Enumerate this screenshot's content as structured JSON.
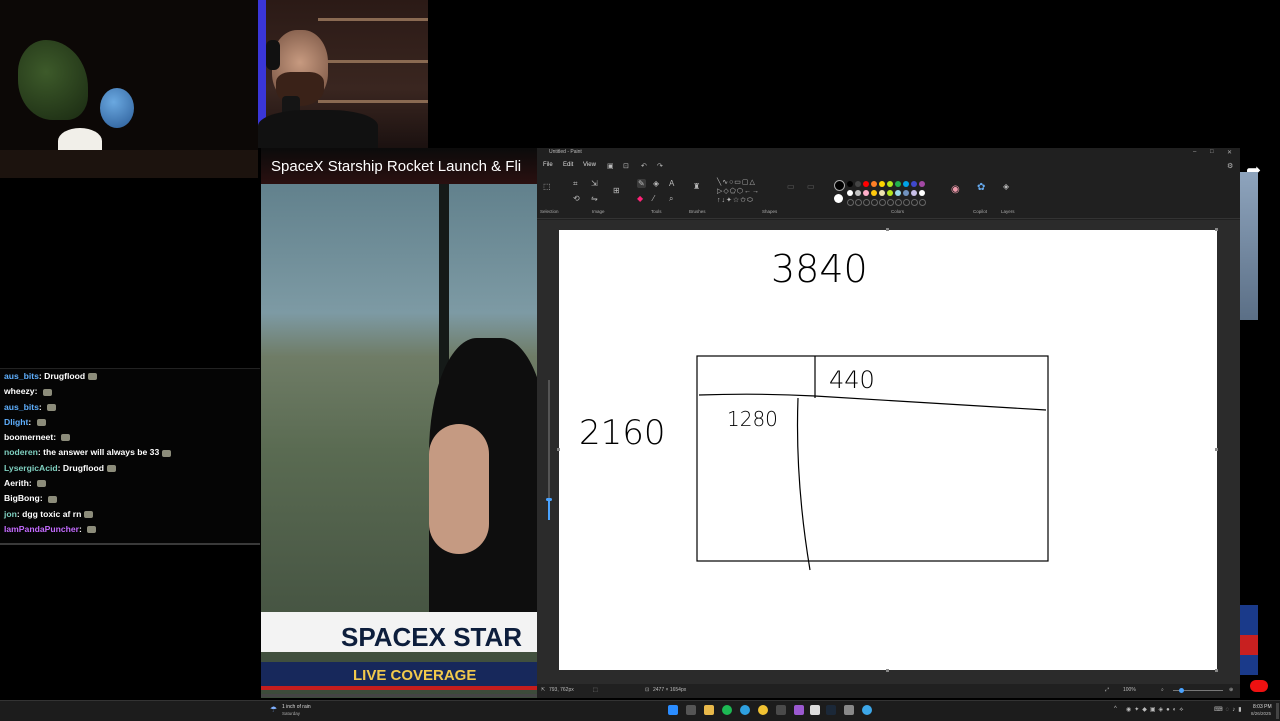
{
  "video": {
    "title": "SpaceX Starship Rocket Launch & Fli",
    "banner_main": "SPACEX STAR",
    "banner_sub": "LIVE COVERAGE"
  },
  "chat": {
    "messages": [
      {
        "user": "aus_bits",
        "text": "Drugflood",
        "color": "#5fb0ff"
      },
      {
        "user": "wheezy",
        "text": "",
        "color": "#ffffff"
      },
      {
        "user": "aus_bits",
        "text": "",
        "color": "#5fb0ff"
      },
      {
        "user": "Dlight",
        "text": "",
        "color": "#5fb0ff"
      },
      {
        "user": "boomerneet",
        "text": "",
        "color": "#ffffff"
      },
      {
        "user": "noderen",
        "text": "the answer will always be 33",
        "color": "#7fd0c0"
      },
      {
        "user": "LysergicAcid",
        "text": "Drugflood",
        "color": "#7fd0c0"
      },
      {
        "user": "Aerith",
        "text": "",
        "color": "#ffffff"
      },
      {
        "user": "BigBong",
        "text": "",
        "color": "#ffffff"
      },
      {
        "user": "jon",
        "text": "dgg toxic af rn",
        "color": "#7fd0c0"
      },
      {
        "user": "IamPandaPuncher",
        "text": "",
        "color": "#c46bff"
      }
    ]
  },
  "paint": {
    "title": "Untitled - Paint",
    "menu": [
      "File",
      "Edit",
      "View"
    ],
    "ribbon_groups": [
      "Selection",
      "Image",
      "Tools",
      "Brushes",
      "Shapes",
      "Colors",
      "Copilot",
      "Layers"
    ],
    "status_position": "793, 762px",
    "status_size": "2477 × 1654px",
    "zoom": "100%",
    "drawing": {
      "width_label": "3840",
      "height_label": "2160",
      "box_top_label": "440",
      "box_left_label": "1280"
    },
    "palette": [
      "#000000",
      "#444444",
      "#ff0000",
      "#ff7f27",
      "#ffd400",
      "#b5e61d",
      "#22b14c",
      "#00a2e8",
      "#3f48cc",
      "#a349a4",
      "#ffffff",
      "#c3c3c3",
      "#ffaec9",
      "#ffc90e",
      "#efe4b0",
      "#b5e61d",
      "#99d9ea",
      "#7092be",
      "#c8bfe7",
      "#ffffff"
    ]
  },
  "taskbar": {
    "weather": "1 inch of rain",
    "weather_day": "Saturday",
    "time": "8:03 PM",
    "date": "8/26/2025"
  }
}
